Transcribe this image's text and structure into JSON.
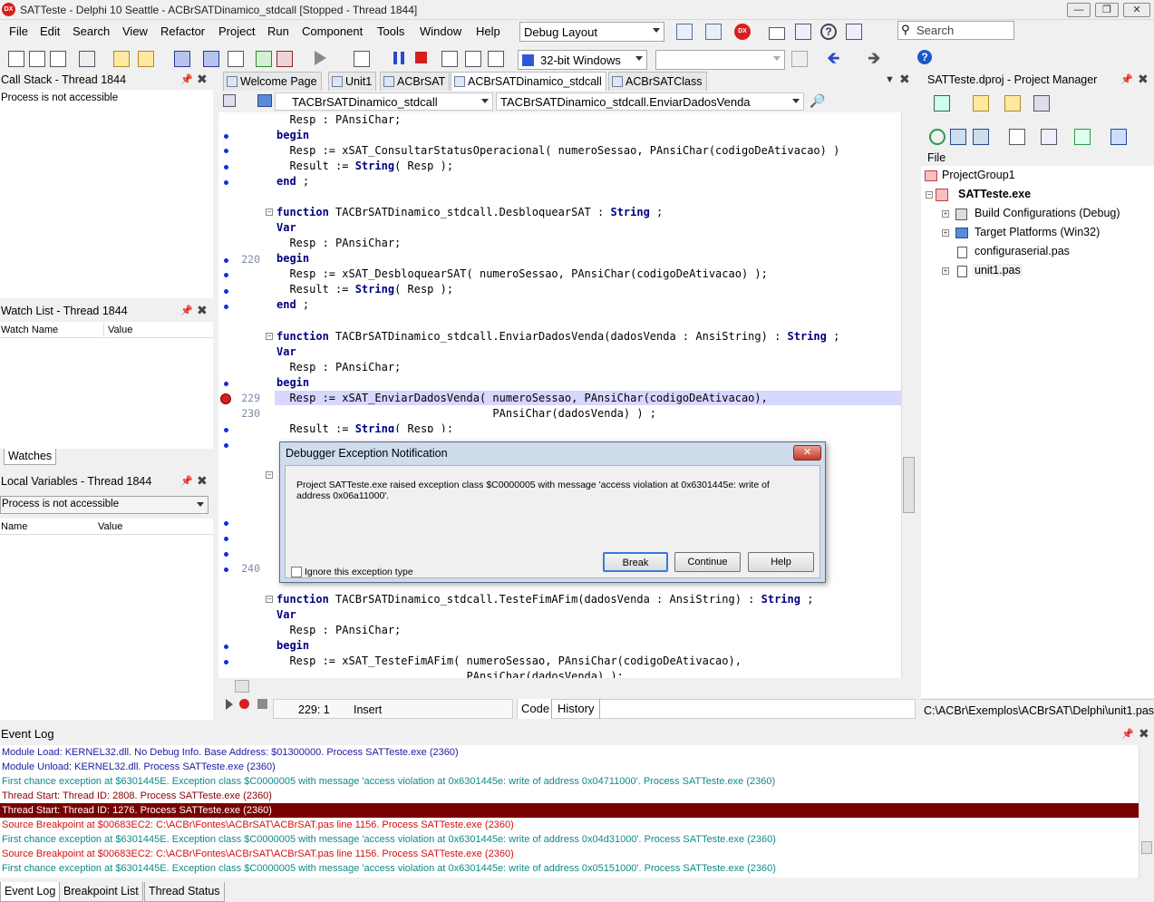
{
  "window": {
    "title": "SATTeste - Delphi 10 Seattle - ACBrSATDinamico_stdcall [Stopped - Thread 1844]",
    "app_icon_text": "DX"
  },
  "menu": [
    "File",
    "Edit",
    "Search",
    "View",
    "Refactor",
    "Project",
    "Run",
    "Component",
    "Tools",
    "Window",
    "Help"
  ],
  "toolbar": {
    "layout": "Debug Layout",
    "platform": "32-bit Windows",
    "search_placeholder": "Search",
    "dx_badge": "DX"
  },
  "call_stack": {
    "title": "Call Stack - Thread 1844",
    "message": "Process is not accessible"
  },
  "watch_list": {
    "title": "Watch List - Thread 1844",
    "col_name": "Watch Name",
    "col_value": "Value",
    "tab": "Watches"
  },
  "local_vars": {
    "title": "Local Variables - Thread 1844",
    "combo": "Process is not accessible",
    "col_name": "Name",
    "col_value": "Value"
  },
  "editor": {
    "tabs": [
      "Welcome Page",
      "Unit1",
      "ACBrSAT",
      "ACBrSATDinamico_stdcall",
      "ACBrSATClass"
    ],
    "class_combo": "TACBrSATDinamico_stdcall",
    "method_combo": "TACBrSATDinamico_stdcall.EnviarDadosVenda",
    "status_pos": "229:  1",
    "status_mode": "Insert",
    "view_tabs": [
      "Code",
      "History"
    ],
    "line_numbers": {
      "l220": "220",
      "l229": "229",
      "l230": "230",
      "l240": "240"
    }
  },
  "code": {
    "l0": "  Resp : PAnsiChar;",
    "l1": "begin",
    "l2a": "  Resp := xSAT_ConsultarStatusOperacional( numeroSessao, PAnsiChar(codigoDeAtivacao) )",
    "l3a": "  Result := ",
    "l3b": "String",
    "l3c": "( Resp );",
    "l4": "end",
    "l4b": " ;",
    "f1a": "function",
    "f1b": " TACBrSATDinamico_stdcall.DesbloquearSAT : ",
    "f1c": "String",
    "f1d": " ;",
    "var": "Var",
    "l7": "  Resp : PAnsiChar;",
    "l9": "  Resp := xSAT_DesbloquearSAT( numeroSessao, PAnsiChar(codigoDeAtivacao) );",
    "f2a": "function",
    "f2b": " TACBrSATDinamico_stdcall.EnviarDadosVenda(dadosVenda : AnsiString) : ",
    "f2c": "String",
    "f2d": " ;",
    "l229": "  Resp := xSAT_EnviarDadosVenda( numeroSessao, PAnsiChar(codigoDeAtivacao),",
    "l230": "                                 PAnsiChar(dadosVenda) ) ;",
    "l231a": "  Result := ",
    "l231b": "String",
    "l231c": "( Resp );",
    "f3a": "function",
    "f3b": " TACBrSATDinamico_stdcall.TesteFimAFim(dadosVenda : AnsiString) : ",
    "f3c": "String",
    "f3d": " ;",
    "l_last1": "  Resp := xSAT_TesteFimAFim( numeroSessao, PAnsiChar(codigoDeAtivacao),",
    "l_last2": "                             PAnsiChar(dadosVenda) );"
  },
  "dialog": {
    "title": "Debugger Exception Notification",
    "message": "Project SATTeste.exe raised exception class $C0000005 with message 'access violation at 0x6301445e: write of address 0x06a11000'.",
    "checkbox": "Ignore this exception type",
    "break": "Break",
    "continue": "Continue",
    "help": "Help"
  },
  "project_manager": {
    "title": "SATTeste.dproj - Project Manager",
    "file_label": "File",
    "items": [
      "ProjectGroup1",
      "SATTeste.exe",
      "Build Configurations (Debug)",
      "Target Platforms (Win32)",
      "configuraserial.pas",
      "unit1.pas"
    ],
    "path": "C:\\ACBr\\Exemplos\\ACBrSAT\\Delphi\\unit1.pas"
  },
  "event_log": {
    "title": "Event Log",
    "lines": [
      {
        "text": "Module Load: KERNEL32.dll. No Debug Info. Base Address: $01300000. Process SATTeste.exe (2360)",
        "color": "#1a1aa8"
      },
      {
        "text": "Module Unload: KERNEL32.dll. Process SATTeste.exe (2360)",
        "color": "#1a1aa8"
      },
      {
        "text": "First chance exception at $6301445E. Exception class $C0000005 with message 'access violation at 0x6301445e: write of address 0x04711000'. Process SATTeste.exe (2360)",
        "color": "#0f8a8a"
      },
      {
        "text": "Thread Start: Thread ID: 2808. Process SATTeste.exe (2360)",
        "color": "#8b0000"
      },
      {
        "text": "Thread Start: Thread ID: 1276. Process SATTeste.exe (2360)",
        "color": "#ffffff"
      },
      {
        "text": "Source Breakpoint at $00683EC2: C:\\ACBr\\Fontes\\ACBrSAT\\ACBrSAT.pas line 1156. Process SATTeste.exe (2360)",
        "color": "#d41010"
      },
      {
        "text": "First chance exception at $6301445E. Exception class $C0000005 with message 'access violation at 0x6301445e: write of address 0x04d31000'. Process SATTeste.exe (2360)",
        "color": "#0f8a8a"
      },
      {
        "text": "Source Breakpoint at $00683EC2: C:\\ACBr\\Fontes\\ACBrSAT\\ACBrSAT.pas line 1156. Process SATTeste.exe (2360)",
        "color": "#d41010"
      },
      {
        "text": "First chance exception at $6301445E. Exception class $C0000005 with message 'access violation at 0x6301445e: write of address 0x05151000'. Process SATTeste.exe (2360)",
        "color": "#0f8a8a"
      }
    ],
    "tabs": [
      "Event Log",
      "Breakpoint List",
      "Thread Status"
    ]
  }
}
